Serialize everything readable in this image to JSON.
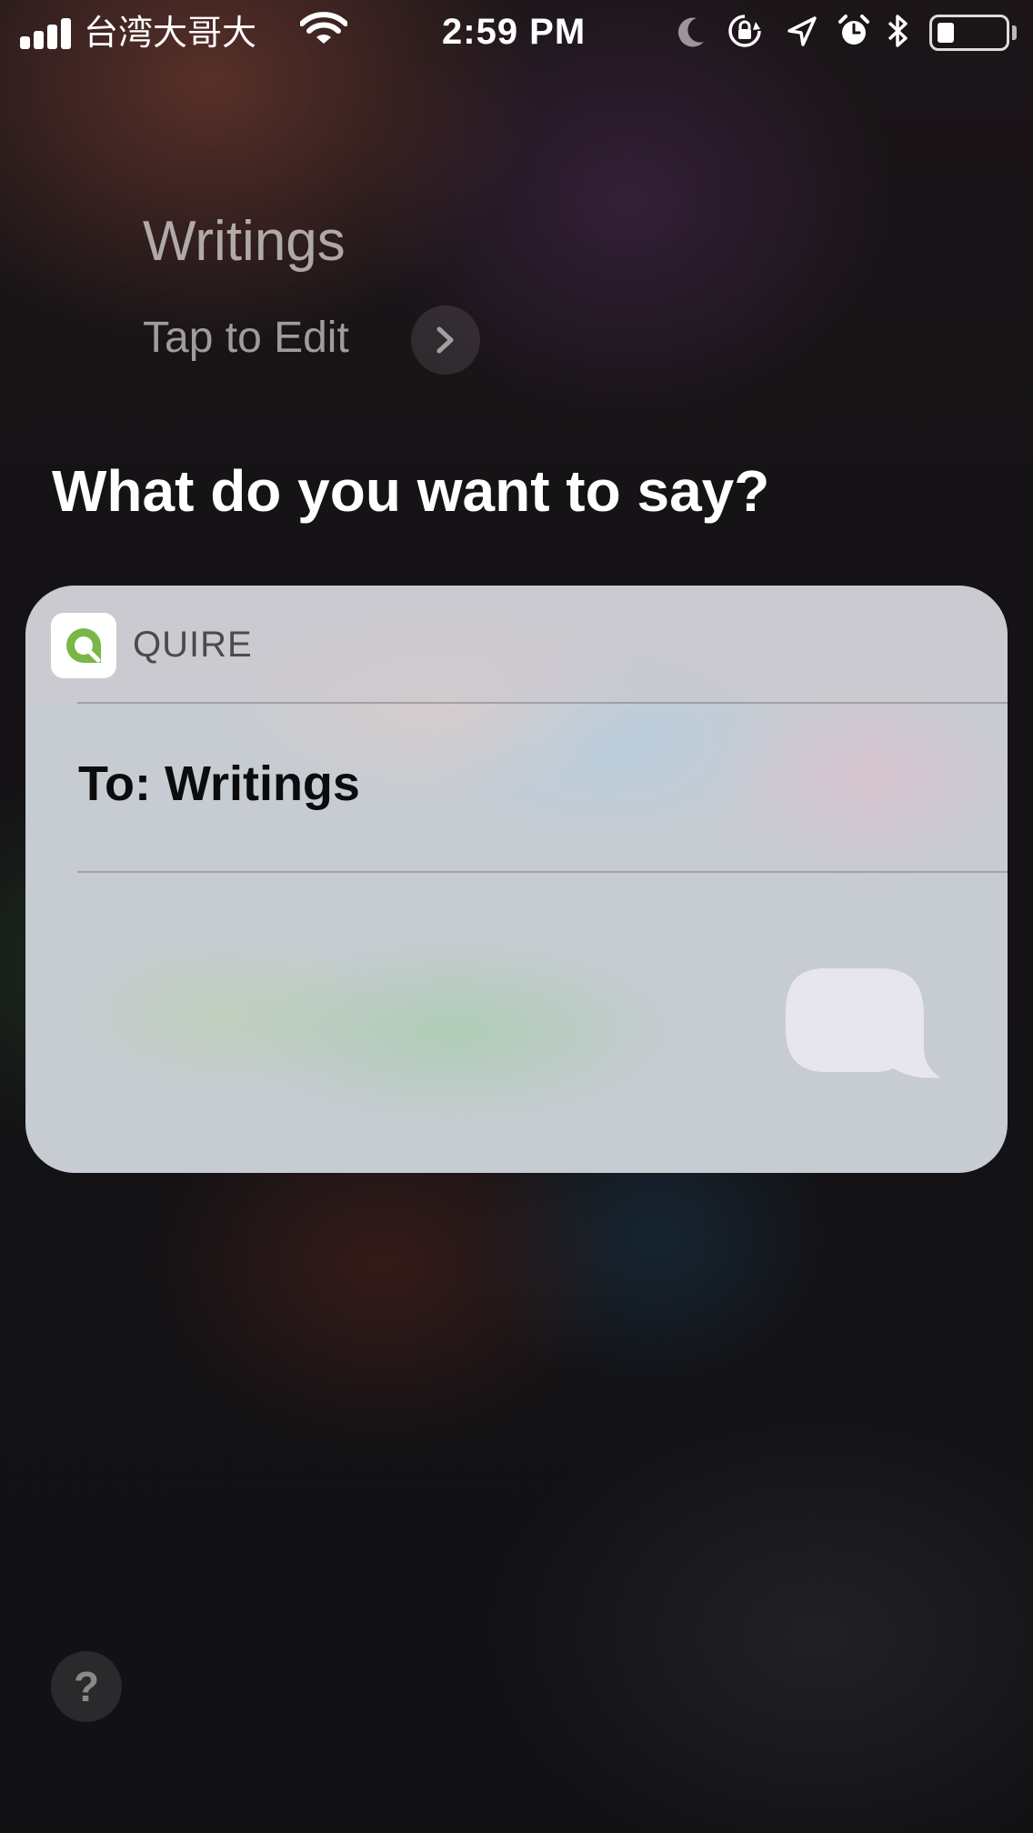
{
  "status_bar": {
    "carrier": "台湾大哥大",
    "time": "2:59 PM",
    "icons": [
      "signal-icon",
      "wifi-icon",
      "moon-icon",
      "rotation-lock-icon",
      "location-icon",
      "alarm-icon",
      "bluetooth-icon",
      "battery-icon"
    ],
    "battery_level": 0.25
  },
  "siri": {
    "query": "Writings",
    "tap_to_edit": "Tap to Edit",
    "prompt": "What do you want to say?"
  },
  "card": {
    "app_name": "QUIRE",
    "app_icon": "quire-logo-icon",
    "app_color": "#7ab648",
    "recipient": "To: Writings",
    "message_icon": "speech-bubble-icon"
  },
  "help": {
    "label": "?"
  }
}
